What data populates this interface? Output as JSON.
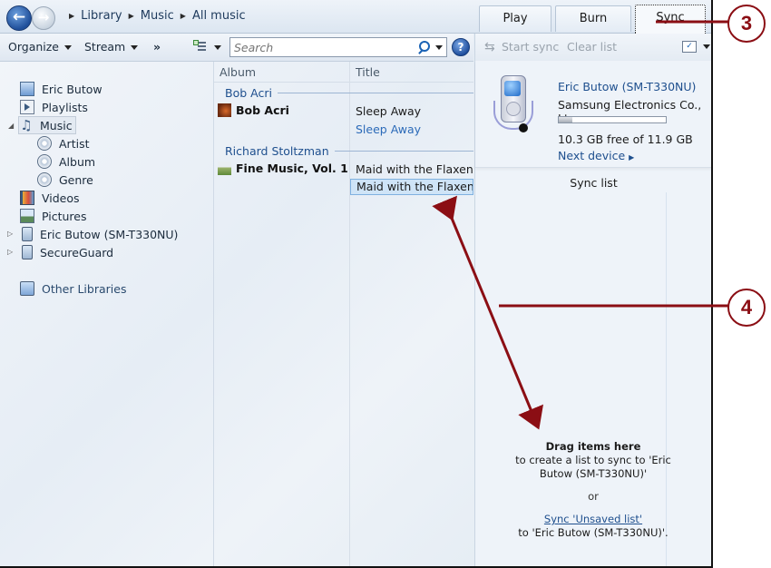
{
  "address": {
    "crumbs": [
      "Library",
      "Music",
      "All music"
    ]
  },
  "tabs": [
    {
      "label": "Play",
      "active": false
    },
    {
      "label": "Burn",
      "active": false
    },
    {
      "label": "Sync",
      "active": true
    }
  ],
  "toolbar": {
    "organize": "Organize",
    "stream": "Stream",
    "more": "»",
    "search_placeholder": "Search",
    "help": "?"
  },
  "nav": {
    "items": [
      {
        "label": "Eric Butow",
        "icon": "user-library-icon"
      },
      {
        "label": "Playlists",
        "icon": "playlist-icon"
      },
      {
        "label": "Music",
        "icon": "music-note-icon",
        "selected": true,
        "expanded": true
      },
      {
        "label": "Artist",
        "icon": "artist-icon"
      },
      {
        "label": "Album",
        "icon": "album-icon"
      },
      {
        "label": "Genre",
        "icon": "genre-icon"
      },
      {
        "label": "Videos",
        "icon": "video-icon"
      },
      {
        "label": "Pictures",
        "icon": "pictures-icon"
      },
      {
        "label": "Eric Butow (SM-T330NU)",
        "icon": "device-icon",
        "collapsed": true
      },
      {
        "label": "SecureGuard",
        "icon": "device-icon",
        "collapsed": true
      },
      {
        "label": "Other Libraries",
        "icon": "other-libraries-icon"
      }
    ]
  },
  "content": {
    "columns": [
      "Album",
      "Title"
    ],
    "groups": [
      {
        "artist": "Bob Acri",
        "album": "Bob Acri",
        "tracks": [
          "Sleep Away",
          "Sleep Away"
        ]
      },
      {
        "artist": "Richard Stoltzman",
        "album": "Fine Music, Vol. 1",
        "tracks": [
          "Maid with the Flaxen Hai",
          "Maid with the Flaxen Hai"
        ]
      }
    ]
  },
  "sync": {
    "start_sync": "Start sync",
    "clear_list": "Clear list",
    "device_name": "Eric Butow (SM-T330NU)",
    "manufacturer": "Samsung Electronics Co., Lt...",
    "storage_used_fraction": 0.13,
    "storage_text": "10.3 GB free of 11.9 GB",
    "next_device": "Next device",
    "list_title": "Sync list",
    "drop_heading": "Drag items here",
    "drop_text": "to create a list to sync to 'Eric Butow (SM-T330NU)'",
    "or": "or",
    "sync_link": "Sync 'Unsaved list'",
    "sync_link_suffix": "to 'Eric Butow (SM-T330NU)'."
  },
  "callouts": [
    "3",
    "4"
  ],
  "colors": {
    "callout": "#8b0e14",
    "link": "#1e4f8e",
    "selection": "#cfe4f7"
  }
}
